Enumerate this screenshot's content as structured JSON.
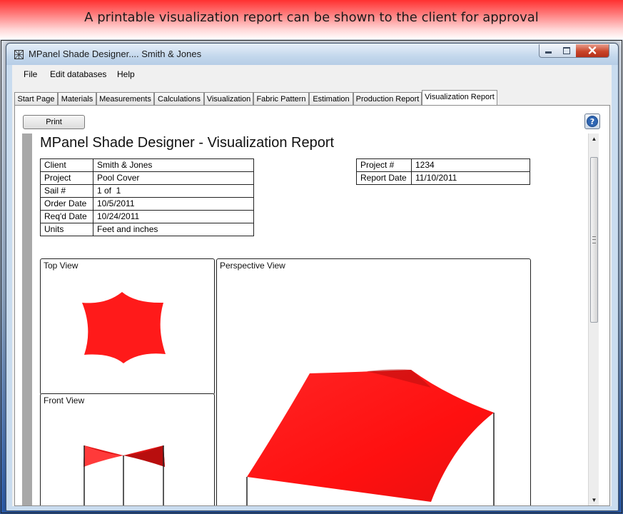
{
  "banner": {
    "caption": "A printable visualization report can be shown to the client for approval"
  },
  "window": {
    "title": "MPanel Shade Designer.... Smith & Jones",
    "icon": "app-grid-icon"
  },
  "menu": {
    "items": [
      "File",
      "Edit databases",
      "Help"
    ]
  },
  "tabs": [
    {
      "label": "Start Page"
    },
    {
      "label": "Materials"
    },
    {
      "label": "Measurements"
    },
    {
      "label": "Calculations"
    },
    {
      "label": "Visualization"
    },
    {
      "label": "Fabric Pattern"
    },
    {
      "label": "Estimation"
    },
    {
      "label": "Production Report"
    },
    {
      "label": "Visualization Report",
      "active": true
    }
  ],
  "toolbar": {
    "print_label": "Print",
    "help_icon": "help-icon",
    "help_glyph": "?"
  },
  "report": {
    "title": "MPanel Shade Designer - Visualization Report",
    "details": [
      {
        "label": "Client",
        "value": "Smith & Jones"
      },
      {
        "label": "Project",
        "value": "Pool Cover"
      },
      {
        "label": "Sail #",
        "value": "1 of  1"
      },
      {
        "label": "Order Date",
        "value": "10/5/2011"
      },
      {
        "label": "Req'd Date",
        "value": "10/24/2011"
      },
      {
        "label": "Units",
        "value": "Feet and inches"
      }
    ],
    "project_info": [
      {
        "label": "Project #",
        "value": "1234"
      },
      {
        "label": "Report Date",
        "value": "11/10/2011"
      }
    ],
    "views": {
      "top": "Top View",
      "front": "Front View",
      "perspective": "Perspective View"
    }
  },
  "colors": {
    "sail": "#ff1a1a",
    "sail_shade": "#c81010",
    "banner": "#ff3030"
  }
}
